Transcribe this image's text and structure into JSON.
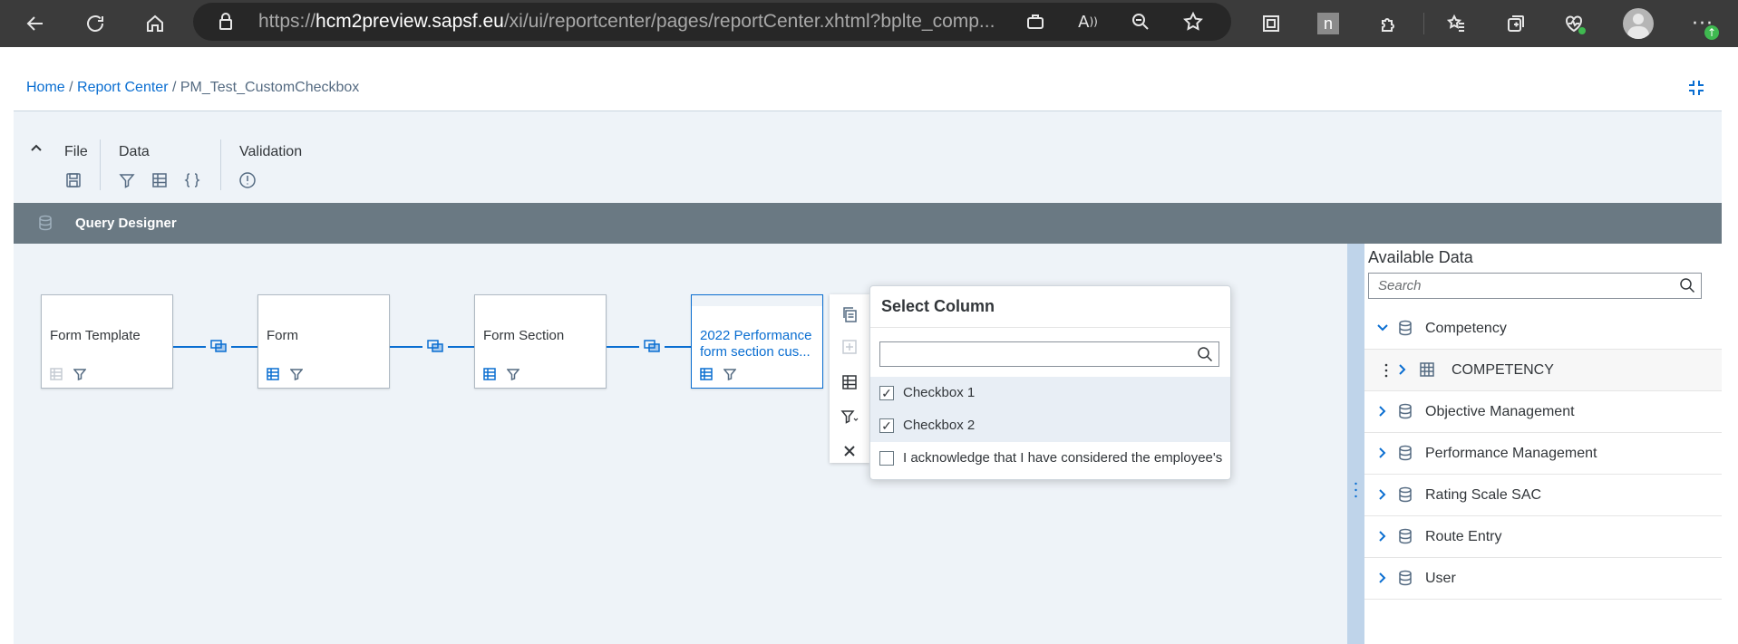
{
  "browser": {
    "url_prefix": "https://",
    "url_domain": "hcm2preview.sapsf.eu",
    "url_rest": "/xi/ui/reportcenter/pages/reportCenter.xhtml?bplte_comp..."
  },
  "breadcrumb": {
    "home": "Home",
    "sep1": " / ",
    "report_center": "Report Center",
    "sep2": " / ",
    "current": "PM_Test_CustomCheckbox"
  },
  "toolbar": {
    "file_label": "File",
    "data_label": "Data",
    "validation_label": "Validation"
  },
  "query_designer": {
    "title": "Query Designer",
    "nodes": [
      {
        "label": "Form Template"
      },
      {
        "label": "Form"
      },
      {
        "label": "Form Section"
      },
      {
        "label": "2022 Performance form section cus..."
      }
    ]
  },
  "select_column": {
    "title": "Select Column",
    "search_value": "",
    "options": [
      {
        "label": "Checkbox 1",
        "checked": true
      },
      {
        "label": "Checkbox 2",
        "checked": true
      },
      {
        "label": "I acknowledge that I have considered the employee's",
        "checked": false
      }
    ]
  },
  "available_data": {
    "title": "Available Data",
    "search_placeholder": "Search",
    "items": [
      {
        "label": "Competency",
        "expanded": true
      },
      {
        "label": "COMPETENCY",
        "child": true
      },
      {
        "label": "Objective Management",
        "expanded": false
      },
      {
        "label": "Performance Management",
        "expanded": false
      },
      {
        "label": "Rating Scale SAC",
        "expanded": false
      },
      {
        "label": "Route Entry",
        "expanded": false
      },
      {
        "label": "User",
        "expanded": false
      }
    ]
  },
  "colors": {
    "accent": "#0a6ed1",
    "header_bar": "#6a7983",
    "splitter": "#bfd4ea"
  }
}
